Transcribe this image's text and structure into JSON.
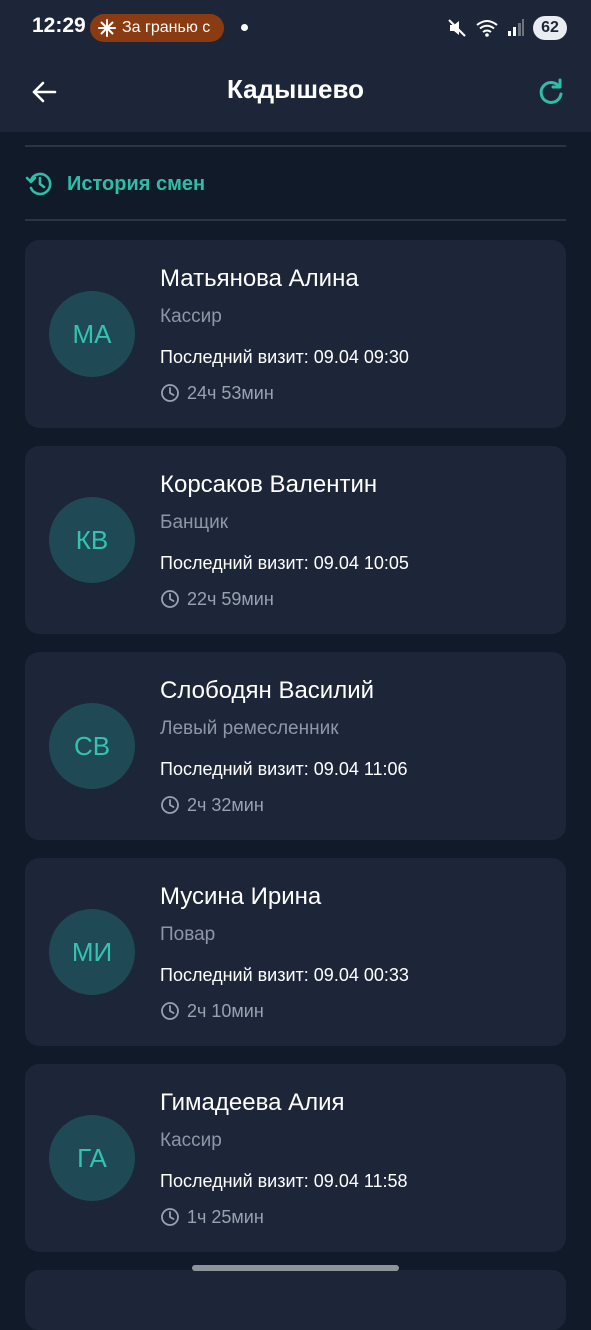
{
  "status_bar": {
    "time": "12:29",
    "notification_text": "За гранью с",
    "battery": "62"
  },
  "app_bar": {
    "title": "Кадышево"
  },
  "history": {
    "label": "История смен"
  },
  "employees": [
    {
      "initials": "МА",
      "name": "Матьянова Алина",
      "role": "Кассир",
      "last_visit": "Последний визит: 09.04 09:30",
      "duration": "24ч 53мин"
    },
    {
      "initials": "КВ",
      "name": "Корсаков Валентин",
      "role": "Банщик",
      "last_visit": "Последний визит: 09.04 10:05",
      "duration": "22ч 59мин"
    },
    {
      "initials": "СВ",
      "name": "Слободян Василий",
      "role": "Левый ремесленник",
      "last_visit": "Последний визит: 09.04 11:06",
      "duration": "2ч 32мин"
    },
    {
      "initials": "МИ",
      "name": "Мусина Ирина",
      "role": "Повар",
      "last_visit": "Последний визит: 09.04 00:33",
      "duration": "2ч 10мин"
    },
    {
      "initials": "ГА",
      "name": "Гимадеева Алия",
      "role": "Кассир",
      "last_visit": "Последний визит: 09.04 11:58",
      "duration": "1ч 25мин"
    }
  ],
  "colors": {
    "background": "#111a29",
    "surface": "#1d2638",
    "accent": "#2dbda8",
    "avatar_bg": "#1f4a55",
    "secondary_text": "#8f97a6"
  },
  "icons": {
    "back": "arrow-left-icon",
    "refresh": "refresh-icon",
    "history": "history-icon",
    "duration": "clock-icon"
  }
}
